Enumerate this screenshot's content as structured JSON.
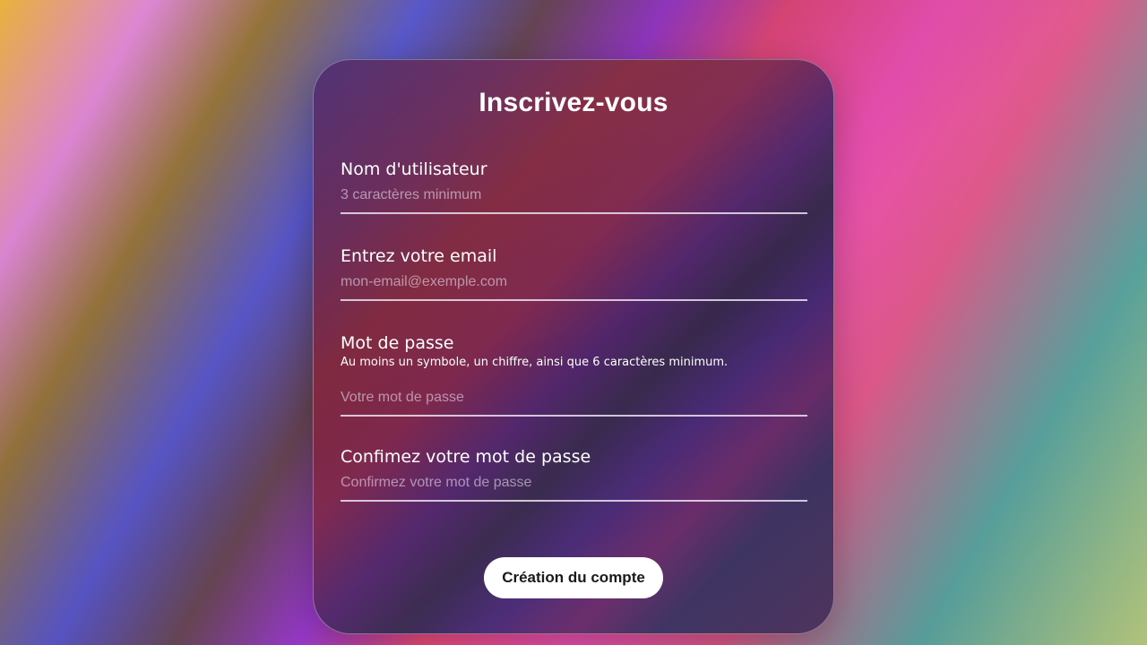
{
  "form": {
    "title": "Inscrivez-vous",
    "fields": {
      "username": {
        "label": "Nom d'utilisateur",
        "placeholder": "3 caractères minimum",
        "value": ""
      },
      "email": {
        "label": "Entrez votre email",
        "placeholder": "mon-email@exemple.com",
        "value": ""
      },
      "password": {
        "label": "Mot de passe",
        "hint": "Au moins un symbole, un chiffre, ainsi que 6 caractères minimum.",
        "placeholder": "Votre mot de passe",
        "value": ""
      },
      "confirm": {
        "label": "Confimez votre mot de passe",
        "placeholder": "Confirmez votre mot de passe",
        "value": ""
      }
    },
    "submit_label": "Création du compte"
  }
}
